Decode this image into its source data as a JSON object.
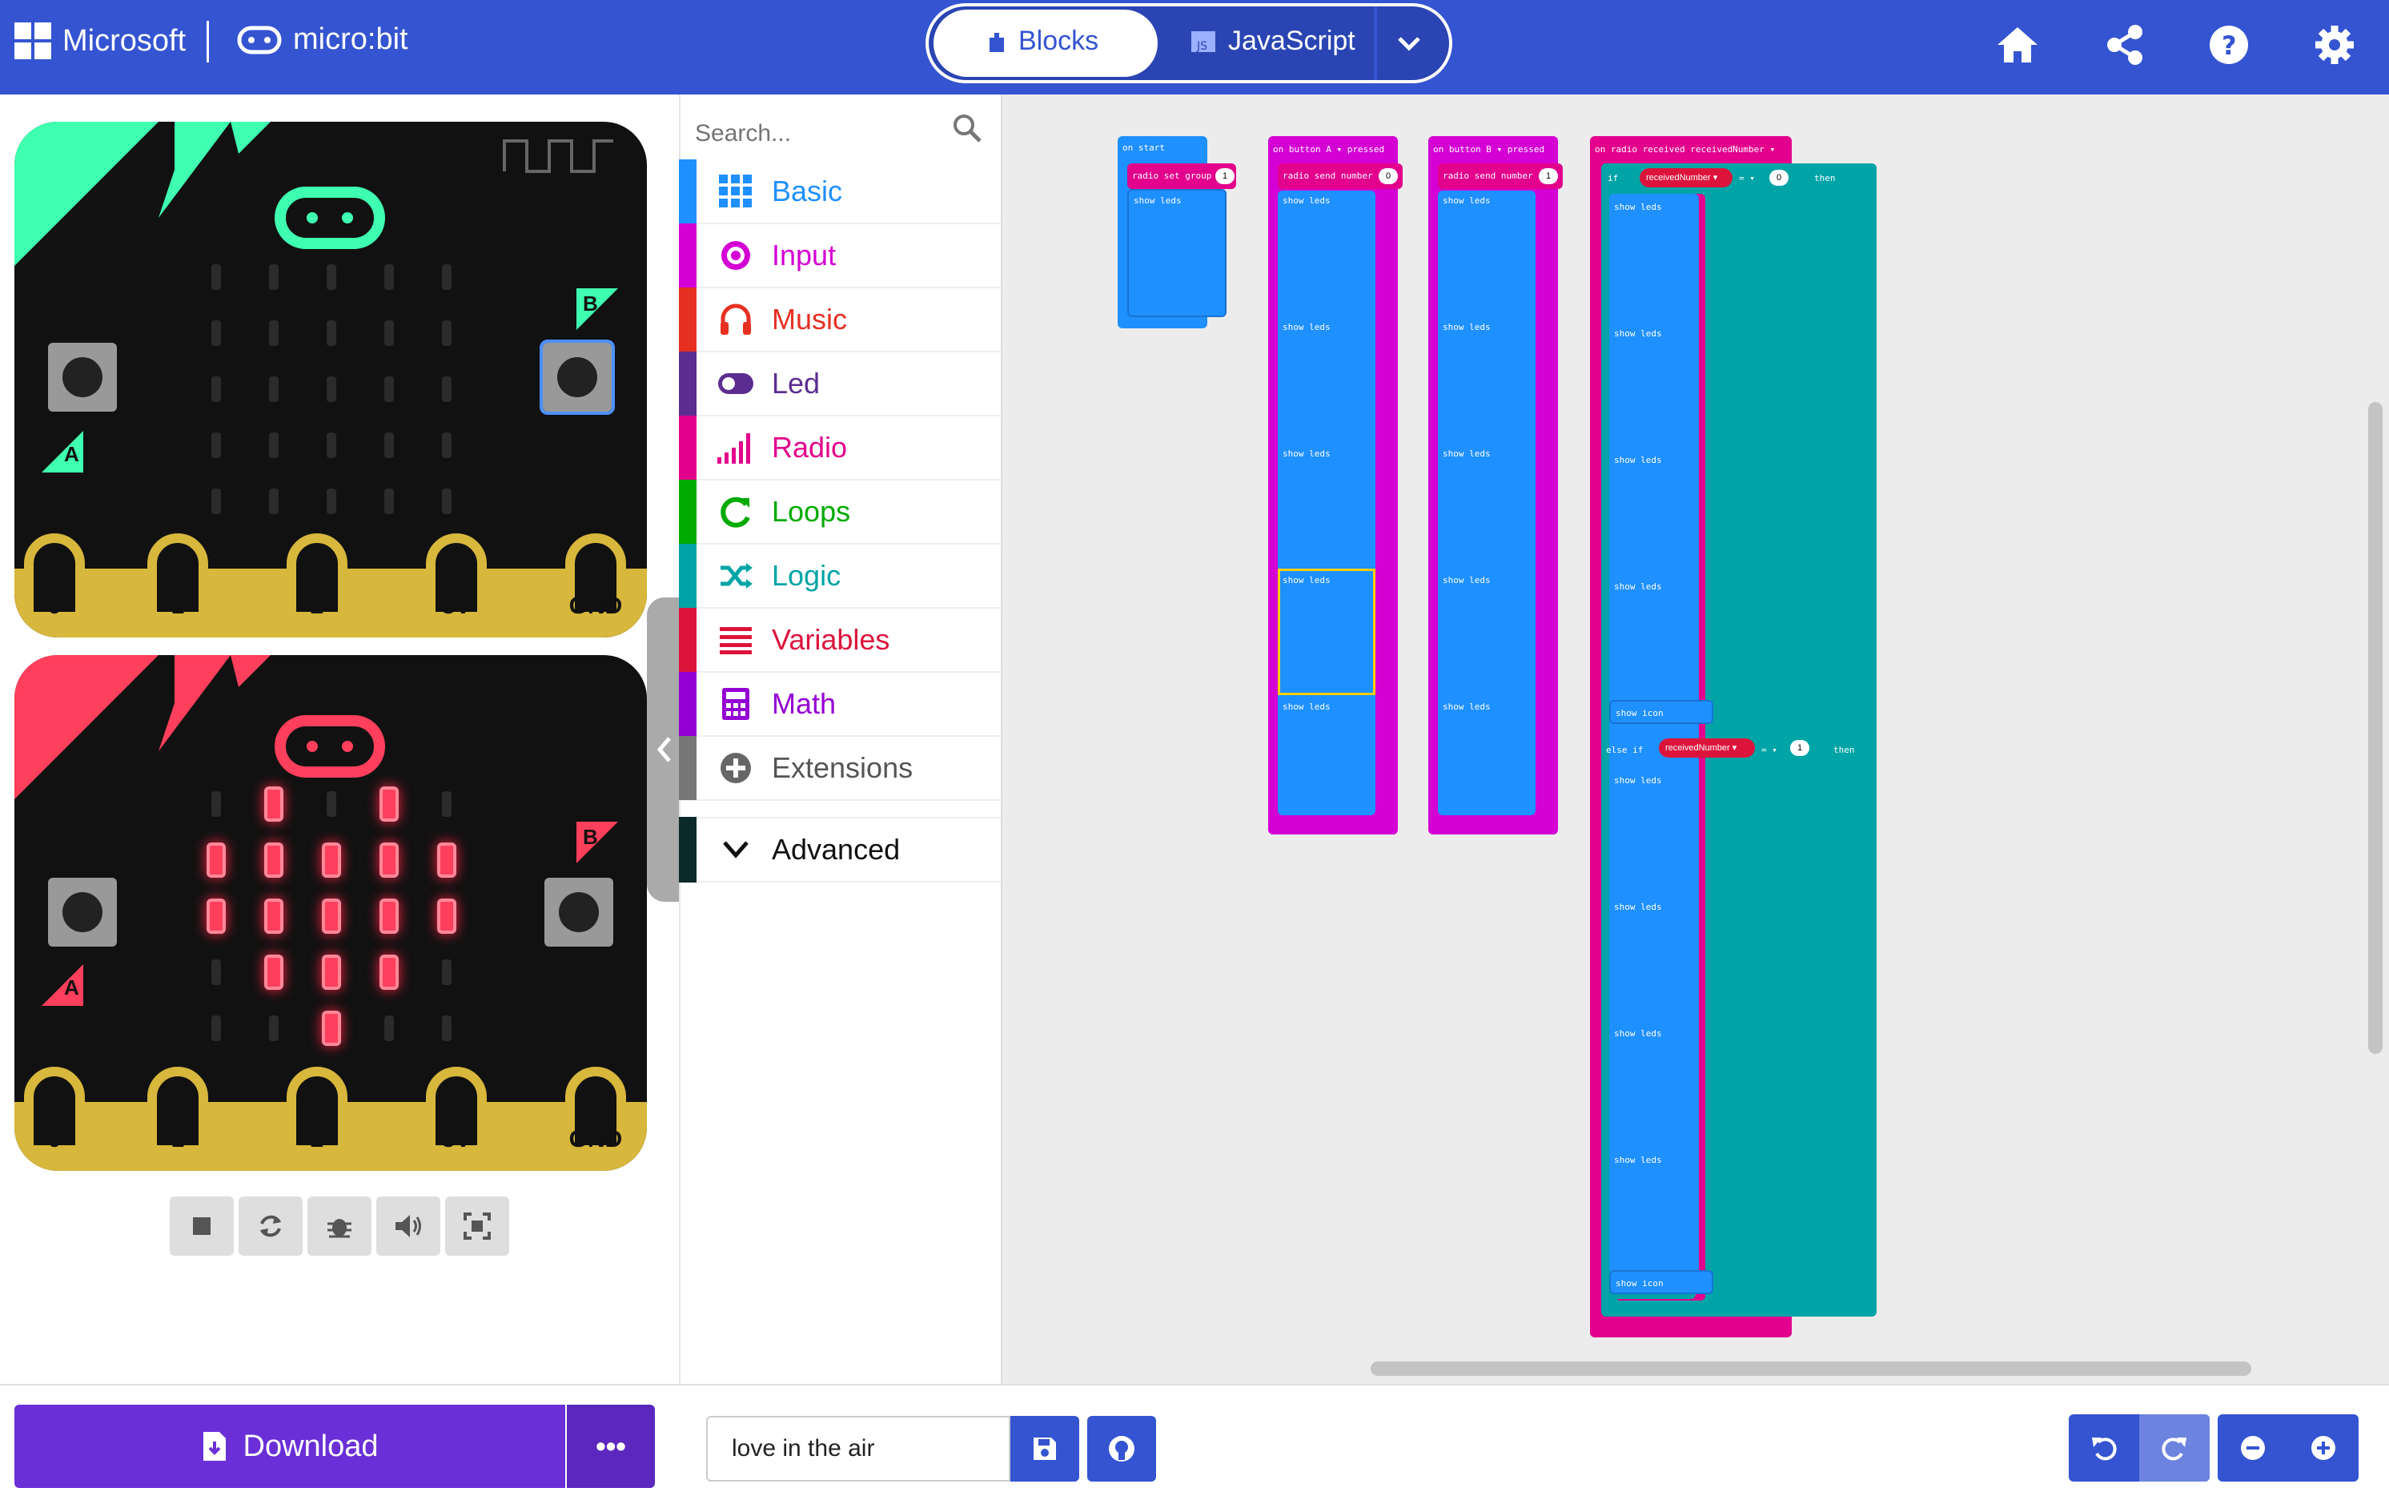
{
  "header": {
    "brand": "Microsoft",
    "product": "micro:bit",
    "tabs": [
      {
        "label": "Blocks"
      },
      {
        "label": "JavaScript"
      }
    ],
    "icons": [
      "home-icon",
      "share-icon",
      "help-icon",
      "settings-icon"
    ]
  },
  "simulator": {
    "pins": [
      "0",
      "1",
      "2",
      "3V",
      "GND"
    ],
    "button_a": "A",
    "button_b": "B",
    "controls": [
      "stop-icon",
      "restart-icon",
      "debug-icon",
      "mute-icon",
      "fullscreen-icon"
    ]
  },
  "toolbox": {
    "search_placeholder": "Search...",
    "categories": [
      {
        "label": "Basic",
        "color": "#1e90ff",
        "icon": "grid-icon"
      },
      {
        "label": "Input",
        "color": "#d400d4",
        "icon": "target-icon"
      },
      {
        "label": "Music",
        "color": "#e63022",
        "icon": "headphones-icon"
      },
      {
        "label": "Led",
        "color": "#5c2d91",
        "icon": "toggle-icon"
      },
      {
        "label": "Radio",
        "color": "#e3008c",
        "icon": "signal-icon"
      },
      {
        "label": "Loops",
        "color": "#00aa00",
        "icon": "loop-icon"
      },
      {
        "label": "Logic",
        "color": "#00a4a6",
        "icon": "shuffle-icon"
      },
      {
        "label": "Variables",
        "color": "#dc143c",
        "icon": "lines-icon"
      },
      {
        "label": "Math",
        "color": "#9400d3",
        "icon": "calculator-icon"
      },
      {
        "label": "Extensions",
        "color": "#777777",
        "icon": "plus-icon"
      }
    ],
    "advanced": "Advanced"
  },
  "workspace": {
    "blocks": {
      "on_start": "on start",
      "radio_set_group": "radio set group",
      "group_value": "1",
      "show_leds": "show leds",
      "on_button_a": "on button A ▾ pressed",
      "on_button_b": "on button B ▾ pressed",
      "radio_send_number": "radio send number",
      "send_a": "0",
      "send_b": "1",
      "on_radio_received": "on radio received receivedNumber ▾",
      "if": "if",
      "else_if": "else if",
      "var": "receivedNumber ▾",
      "eq": "= ▾",
      "cmp_0": "0",
      "cmp_1": "1",
      "then": "then",
      "show_icon": "show icon"
    }
  },
  "footer": {
    "download": "Download",
    "more": "•••",
    "project_name": "love in the air"
  }
}
